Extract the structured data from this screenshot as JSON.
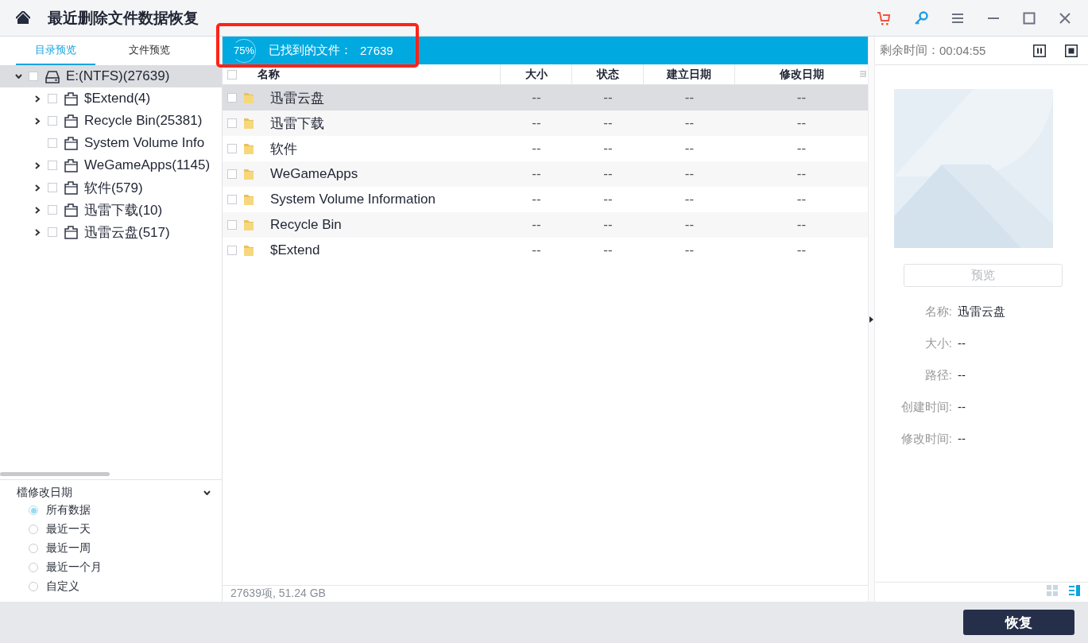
{
  "window": {
    "title": "最近删除文件数据恢复"
  },
  "left_tabs": [
    {
      "label": "目录预览",
      "selected": true
    },
    {
      "label": "文件预览",
      "selected": false
    }
  ],
  "tree": [
    {
      "label": "E:(NTFS)(27639)",
      "kind": "drive",
      "expanded": true,
      "selected": true,
      "checked": false,
      "children": [
        {
          "label": "$Extend(4)",
          "kind": "folder",
          "expanded": false,
          "selected": false,
          "checked": false
        },
        {
          "label": "Recycle Bin(25381)",
          "kind": "folder",
          "expanded": false,
          "selected": false,
          "checked": false
        },
        {
          "label": "System Volume Info",
          "kind": "folder",
          "selected": false,
          "checked": false
        },
        {
          "label": "WeGameApps(1145)",
          "kind": "folder",
          "expanded": false,
          "selected": false,
          "checked": false
        },
        {
          "label": "软件(579)",
          "kind": "folder",
          "expanded": false,
          "selected": false,
          "checked": false
        },
        {
          "label": "迅雷下载(10)",
          "kind": "folder",
          "expanded": false,
          "selected": false,
          "checked": false
        },
        {
          "label": "迅雷云盘(517)",
          "kind": "folder",
          "expanded": false,
          "selected": false,
          "checked": false
        }
      ]
    }
  ],
  "filter": {
    "title": "檔修改日期",
    "expanded": true,
    "options": [
      {
        "label": "所有数据",
        "selected": true
      },
      {
        "label": "最近一天",
        "selected": false
      },
      {
        "label": "最近一周",
        "selected": false
      },
      {
        "label": "最近一个月",
        "selected": false
      },
      {
        "label": "自定义",
        "selected": false
      }
    ]
  },
  "scan": {
    "progress": "75%",
    "found_label": "已找到的文件：",
    "found_count": "27639"
  },
  "table": {
    "all_checked": false,
    "columns": [
      "名称",
      "大小",
      "状态",
      "建立日期",
      "修改日期"
    ],
    "rows": [
      {
        "name": "迅雷云盘",
        "size": "--",
        "status": "--",
        "created": "--",
        "modified": "--",
        "selected": true,
        "checked": false
      },
      {
        "name": "迅雷下载",
        "size": "--",
        "status": "--",
        "created": "--",
        "modified": "--",
        "selected": false,
        "checked": false
      },
      {
        "name": "软件",
        "size": "--",
        "status": "--",
        "created": "--",
        "modified": "--",
        "selected": false,
        "checked": false
      },
      {
        "name": "WeGameApps",
        "size": "--",
        "status": "--",
        "created": "--",
        "modified": "--",
        "selected": false,
        "checked": false
      },
      {
        "name": "System Volume Information",
        "size": "--",
        "status": "--",
        "created": "--",
        "modified": "--",
        "selected": false,
        "checked": false
      },
      {
        "name": "Recycle Bin",
        "size": "--",
        "status": "--",
        "created": "--",
        "modified": "--",
        "selected": false,
        "checked": false
      },
      {
        "name": "$Extend",
        "size": "--",
        "status": "--",
        "created": "--",
        "modified": "--",
        "selected": false,
        "checked": false
      }
    ]
  },
  "status_bar": {
    "summary": "27639项, 51.24  GB"
  },
  "view_modes": [
    {
      "kind": "grid",
      "selected": false
    },
    {
      "kind": "list",
      "selected": true
    }
  ],
  "remaining": {
    "label": "剩余时间：",
    "value": "00:04:55"
  },
  "details": {
    "preview_button": "预览",
    "name": {
      "label": "名称:",
      "text": "迅雷云盘"
    },
    "size": {
      "label": "大小:",
      "text": "--"
    },
    "path": {
      "label": "路径:",
      "text": "--"
    },
    "created": {
      "label": "创建时间:",
      "text": "--"
    },
    "modified": {
      "label": "修改时间:",
      "text": "--"
    }
  },
  "recover_button": "恢复"
}
